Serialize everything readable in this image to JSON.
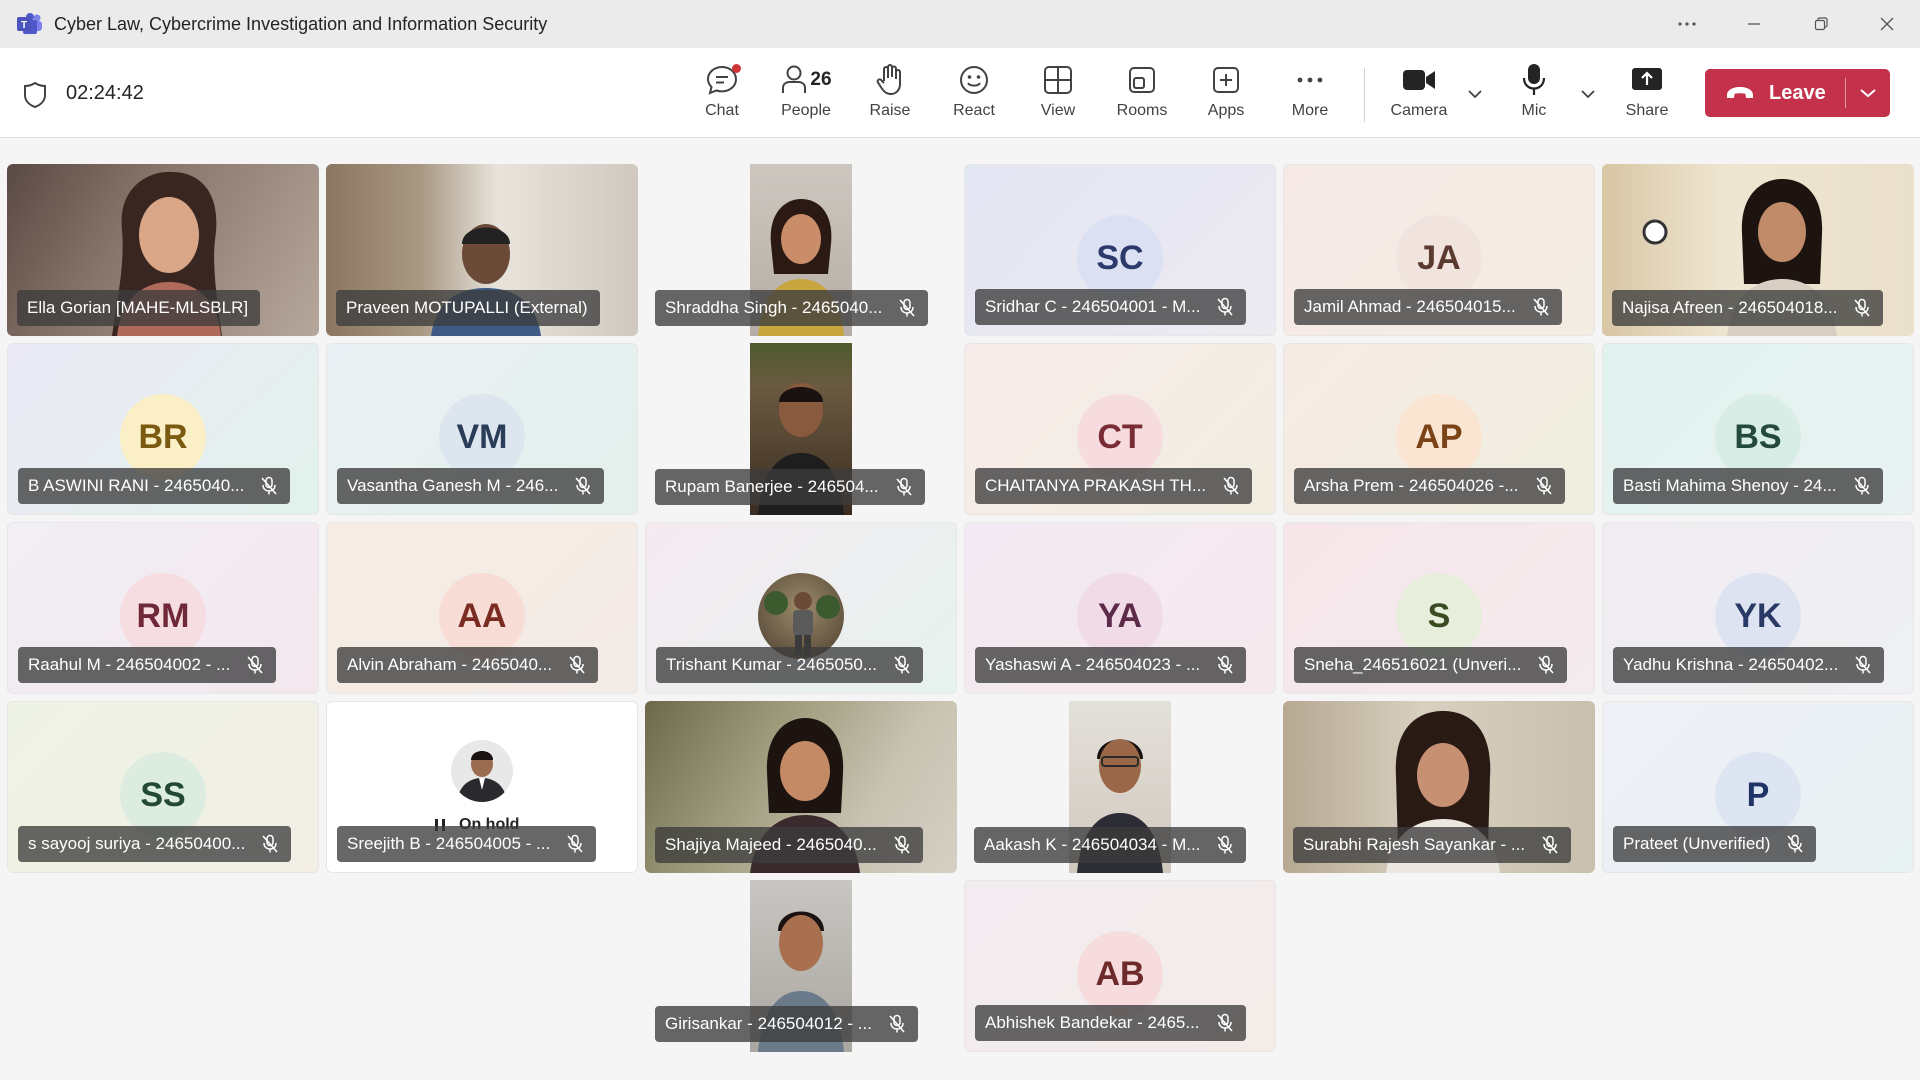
{
  "window": {
    "title": "Cyber Law, Cybercrime Investigation and Information Security"
  },
  "toolbar": {
    "timer": "02:24:42",
    "people_count": "26",
    "buttons": {
      "chat": "Chat",
      "people": "People",
      "raise": "Raise",
      "react": "React",
      "view": "View",
      "rooms": "Rooms",
      "apps": "Apps",
      "more": "More",
      "camera": "Camera",
      "mic": "Mic",
      "share": "Share"
    },
    "leave_label": "Leave"
  },
  "colors": {
    "leave": "#c4314b",
    "accent": "#5b5fc7",
    "notification": "#d13438"
  },
  "on_hold_label": "On hold",
  "participants": [
    {
      "name": "Ella Gorian [MAHE-MLSBLR]",
      "type": "video"
    },
    {
      "name": "Praveen MOTUPALLI (External)",
      "type": "video"
    },
    {
      "name": "Shraddha Singh - 2465040...",
      "type": "video"
    },
    {
      "name": "Sridhar C - 246504001 - M...",
      "initials": "SC"
    },
    {
      "name": "Jamil Ahmad - 246504015...",
      "initials": "JA"
    },
    {
      "name": "Najisa Afreen - 246504018...",
      "type": "video"
    },
    {
      "name": "B ASWINI RANI - 2465040...",
      "initials": "BR"
    },
    {
      "name": "Vasantha Ganesh M - 246...",
      "initials": "VM"
    },
    {
      "name": "Rupam Banerjee - 246504...",
      "type": "video"
    },
    {
      "name": "CHAITANYA PRAKASH TH...",
      "initials": "CT"
    },
    {
      "name": "Arsha Prem - 246504026 -...",
      "initials": "AP"
    },
    {
      "name": "Basti Mahima Shenoy - 24...",
      "initials": "BS"
    },
    {
      "name": "Raahul M - 246504002 - ...",
      "initials": "RM"
    },
    {
      "name": "Alvin Abraham - 2465040...",
      "initials": "AA"
    },
    {
      "name": "Trishant Kumar - 2465050...",
      "type": "photo"
    },
    {
      "name": "Yashaswi A - 246504023 - ...",
      "initials": "YA"
    },
    {
      "name": "Sneha_246516021 (Unveri...",
      "initials": "S"
    },
    {
      "name": "Yadhu Krishna - 24650402...",
      "initials": "YK"
    },
    {
      "name": "s sayooj suriya - 24650400...",
      "initials": "SS"
    },
    {
      "name": "Sreejith B - 246504005 - ...",
      "type": "onhold"
    },
    {
      "name": "Shajiya Majeed - 2465040...",
      "type": "video"
    },
    {
      "name": "Aakash K - 246504034 - M...",
      "type": "video"
    },
    {
      "name": "Surabhi Rajesh Sayankar - ...",
      "type": "video"
    },
    {
      "name": "Prateet (Unverified)",
      "initials": "P"
    },
    {
      "name": "Girisankar - 246504012 - ...",
      "type": "video"
    },
    {
      "name": "Abhishek Bandekar - 2465...",
      "initials": "AB"
    }
  ]
}
